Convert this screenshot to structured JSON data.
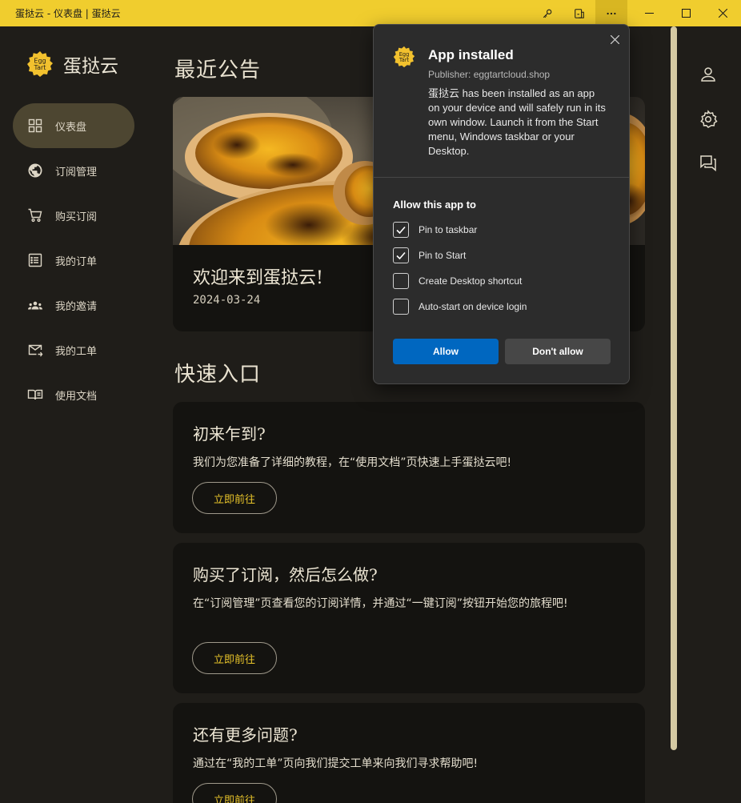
{
  "window": {
    "title": "蛋挞云 - 仪表盘 | 蛋挞云",
    "toolbar_icons": [
      "key-icon",
      "app-available-icon",
      "more-icon"
    ],
    "controls": [
      "minimize-icon",
      "maximize-icon",
      "close-icon"
    ],
    "titlebar_color": "#f0cd2e"
  },
  "brand": {
    "name": "蛋挞云",
    "logo_text_1": "Egg",
    "logo_text_2": "Tart"
  },
  "sidebar": {
    "items": [
      {
        "label": "仪表盘",
        "icon": "dashboard-icon",
        "active": true
      },
      {
        "label": "订阅管理",
        "icon": "globe-icon"
      },
      {
        "label": "购买订阅",
        "icon": "cart-icon"
      },
      {
        "label": "我的订单",
        "icon": "list-icon"
      },
      {
        "label": "我的邀请",
        "icon": "group-icon"
      },
      {
        "label": "我的工单",
        "icon": "mail-forward-icon"
      },
      {
        "label": "使用文档",
        "icon": "book-icon"
      }
    ]
  },
  "rail": {
    "icons": [
      "user-icon",
      "settings-icon",
      "chat-icon"
    ]
  },
  "main": {
    "announcements_title": "最近公告",
    "announcement": {
      "title": "欢迎来到蛋挞云!",
      "date": "2024-03-24"
    },
    "quick_title": "快速入口",
    "quick_cards": [
      {
        "title": "初来乍到?",
        "text": "我们为您准备了详细的教程，在“使用文档”页快速上手蛋挞云吧!",
        "button": "立即前往"
      },
      {
        "title": "购买了订阅，然后怎么做?",
        "text": "在“订阅管理”页查看您的订阅详情，并通过“一键订阅”按钮开始您的旅程吧!",
        "button": "立即前往"
      },
      {
        "title": "还有更多问题?",
        "text": "通过在“我的工单”页向我们提交工单来向我们寻求帮助吧!",
        "button": "立即前往"
      }
    ]
  },
  "popup": {
    "title": "App installed",
    "publisher": "Publisher: eggtartcloud.shop",
    "description": "蛋挞云 has been installed as an app on your device and will safely run in its own window. Launch it from the Start menu, Windows taskbar or your Desktop.",
    "allow_title": "Allow this app to",
    "options": [
      {
        "label": "Pin to taskbar",
        "checked": true
      },
      {
        "label": "Pin to Start",
        "checked": true
      },
      {
        "label": "Create Desktop shortcut",
        "checked": false
      },
      {
        "label": "Auto-start on device login",
        "checked": false
      }
    ],
    "allow_button": "Allow",
    "deny_button": "Don't allow",
    "accent": "#0067c0"
  }
}
